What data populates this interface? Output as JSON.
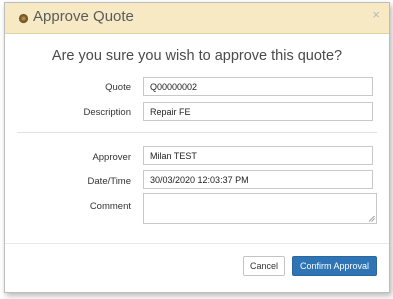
{
  "dialog": {
    "title": "Approve Quote",
    "close_glyph": "×",
    "question": "Are you sure you wish to approve this quote?",
    "header_icon": "circle-icon",
    "accent_color": "#f6e9c4"
  },
  "fields": {
    "quote": {
      "label": "Quote",
      "value": "Q00000002"
    },
    "description": {
      "label": "Description",
      "value": "Repair FE"
    },
    "approver": {
      "label": "Approver",
      "value": "Milan TEST"
    },
    "datetime": {
      "label": "Date/Time",
      "value": "30/03/2020 12:03:37 PM"
    },
    "comment": {
      "label": "Comment",
      "value": ""
    }
  },
  "buttons": {
    "cancel_label": "Cancel",
    "confirm_label": "Confirm Approval",
    "confirm_color": "#2f74b5"
  }
}
